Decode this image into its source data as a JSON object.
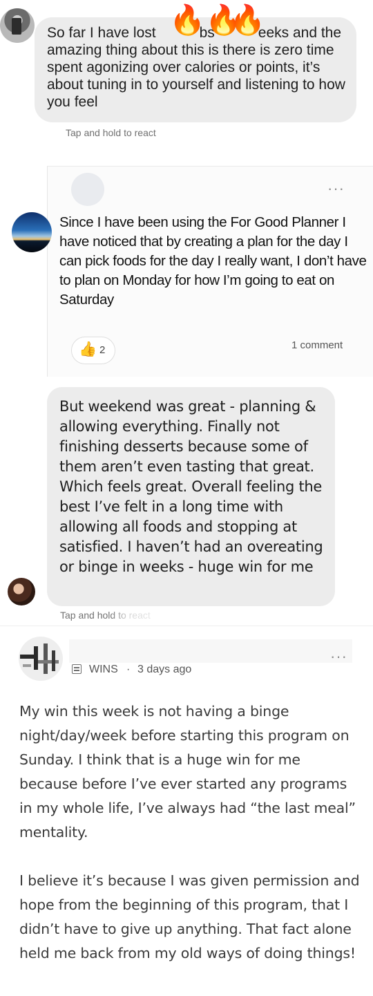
{
  "message_1": {
    "text": "So far I have lost   bs   eeks and the amazing thing about this is there is zero time spent agonizing over calories or points, it’s about tuning in to yourself and listening to how you feel",
    "decoration": "🔥",
    "hint": "Tap and hold to react"
  },
  "post_2": {
    "text": "Since I have been using the For Good Planner I have noticed that by creating a plan for the day I can pick foods for the day I really want, I don’t have to plan on Monday for how I’m going to eat on Saturday",
    "menu": "···",
    "reaction_emoji": "👍",
    "reaction_count": "2",
    "comments": "1 comment"
  },
  "message_3": {
    "text": "But weekend was great - planning & allowing everything. Finally not finishing desserts because some of them aren’t even tasting that great. Which feels great. Overall feeling the best I’ve felt in a long time with allowing all foods and stopping at satisfied. I haven’t had an overeating or binge in weeks - huge win for me",
    "hint": "Tap and hold to react"
  },
  "post_4": {
    "category": "WINS",
    "separator": "·",
    "time": "3 days ago",
    "menu": "···",
    "paragraph_1": "My win this week is not having a binge night/day/week before starting this program on Sunday. I think that is a huge win for me because before I’ve ever started any programs in my whole life, I’ve always had “the last meal” mentality.",
    "paragraph_2": "I believe it’s because I was given permission and hope from the beginning of this program, that I didn’t have to give up anything. That fact alone held me back from my old ways of doing things!"
  }
}
